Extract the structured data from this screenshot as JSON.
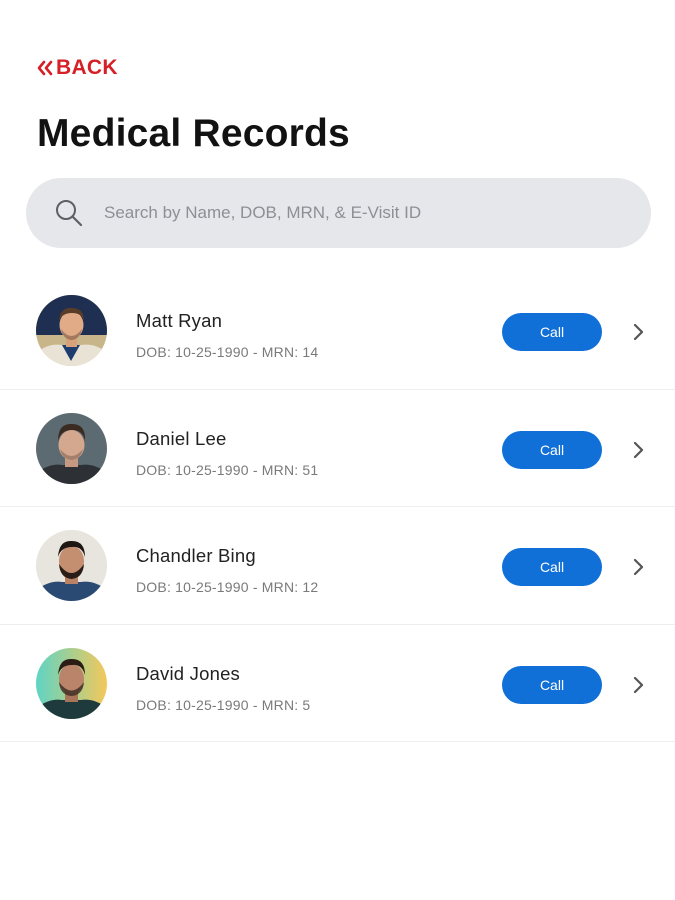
{
  "header": {
    "back_label": "BACK",
    "title": "Medical Records"
  },
  "search": {
    "placeholder": "Search by Name, DOB, MRN, & E-Visit ID",
    "value": ""
  },
  "patients": [
    {
      "name": "Matt Ryan",
      "meta": "DOB: 10-25-1990 - MRN: 14",
      "call_label": "Call"
    },
    {
      "name": "Daniel Lee",
      "meta": "DOB: 10-25-1990 - MRN: 51",
      "call_label": "Call"
    },
    {
      "name": "Chandler Bing",
      "meta": "DOB: 10-25-1990 - MRN: 12",
      "call_label": "Call"
    },
    {
      "name": "David Jones",
      "meta": "DOB: 10-25-1990 - MRN: 5",
      "call_label": "Call"
    }
  ],
  "colors": {
    "accent": "#d61f26",
    "call_button": "#1170d8",
    "search_bg": "#e6e7ea"
  },
  "icons": {
    "back": "double-chevron-left-icon",
    "search": "search-icon",
    "row_chevron": "chevron-right-icon"
  }
}
